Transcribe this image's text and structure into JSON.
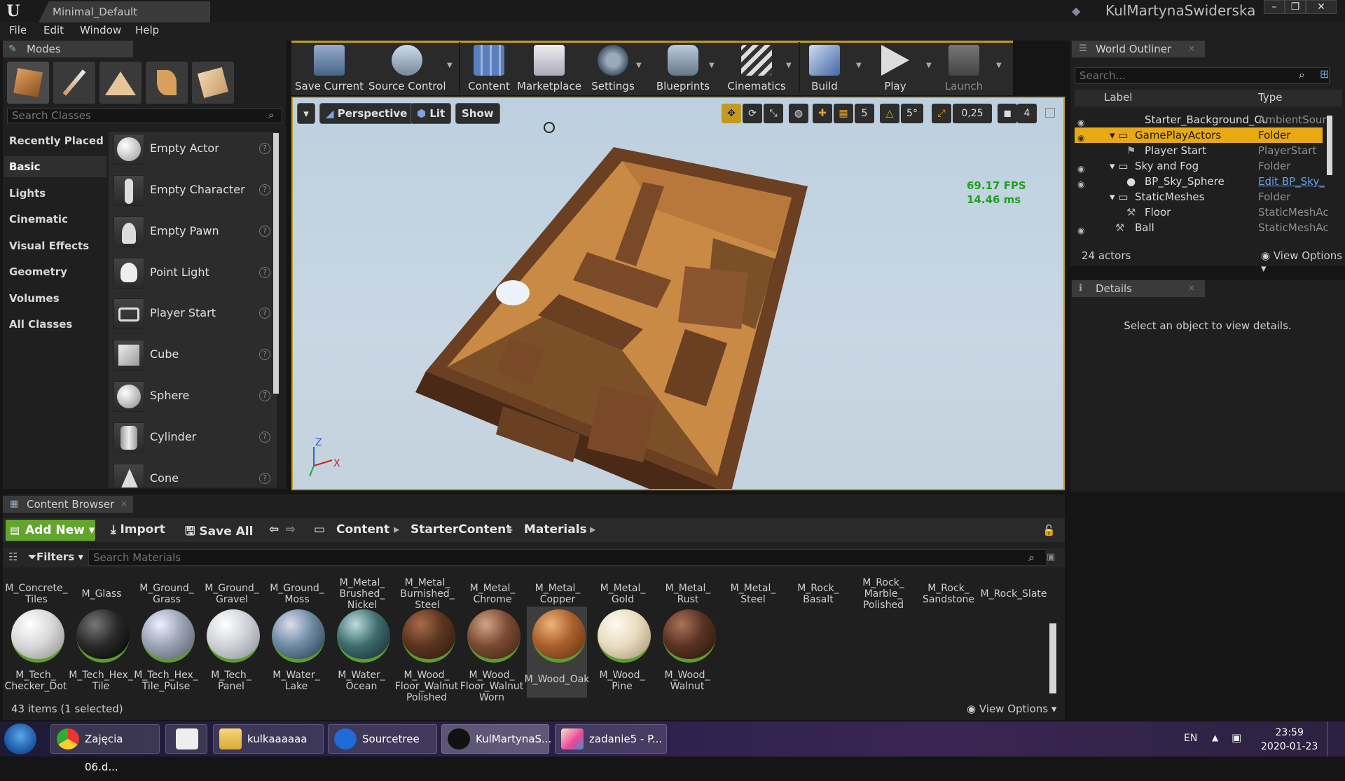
{
  "window": {
    "tab_title": "Minimal_Default",
    "user": "KulMartynaSwiderska"
  },
  "menu": [
    "File",
    "Edit",
    "Window",
    "Help"
  ],
  "modes": {
    "tab": "Modes",
    "search_placeholder": "Search Classes",
    "categories": [
      "Recently Placed",
      "Basic",
      "Lights",
      "Cinematic",
      "Visual Effects",
      "Geometry",
      "Volumes",
      "All Classes"
    ],
    "active_category": "Basic",
    "items": [
      "Empty Actor",
      "Empty Character",
      "Empty Pawn",
      "Point Light",
      "Player Start",
      "Cube",
      "Sphere",
      "Cylinder",
      "Cone"
    ]
  },
  "toolbar": {
    "buttons": [
      "Save Current",
      "Source Control",
      "Content",
      "Marketplace",
      "Settings",
      "Blueprints",
      "Cinematics",
      "Build",
      "Play",
      "Launch"
    ]
  },
  "viewport": {
    "mode_dropdown": "▾",
    "perspective": "Perspective",
    "lit": "Lit",
    "show": "Show",
    "grid_snap": "5",
    "rot_snap": "5°",
    "scale_snap": "0,25",
    "cam_speed": "4",
    "fps": "69.17 FPS",
    "ms": "14.46 ms",
    "axis_z": "Z",
    "axis_x": "X"
  },
  "outliner": {
    "tab": "World Outliner",
    "search_placeholder": "Search...",
    "col_label": "Label",
    "col_type": "Type",
    "rows": [
      {
        "label": "Starter_Background_Cu",
        "type": "AmbientSoun",
        "indent": 2
      },
      {
        "label": "GamePlayActors",
        "type": "Folder",
        "indent": 1,
        "selected": true
      },
      {
        "label": "Player Start",
        "type": "PlayerStart",
        "indent": 2
      },
      {
        "label": "Sky and Fog",
        "type": "Folder",
        "indent": 1
      },
      {
        "label": "BP_Sky_Sphere",
        "type": "Edit BP_Sky_",
        "indent": 2
      },
      {
        "label": "StaticMeshes",
        "type": "Folder",
        "indent": 1
      },
      {
        "label": "Floor",
        "type": "StaticMeshAc",
        "indent": 2
      },
      {
        "label": "Ball",
        "type": "StaticMeshAc",
        "indent": 1
      }
    ],
    "actors_count": "24 actors",
    "view_options": "View Options"
  },
  "details": {
    "tab": "Details",
    "message": "Select an object to view details."
  },
  "content_browser": {
    "tab": "Content Browser",
    "add_new": "Add New",
    "import": "Import",
    "save_all": "Save All",
    "breadcrumb": [
      "Content",
      "StarterContent",
      "Materials"
    ],
    "filters": "Filters",
    "search_placeholder": "Search Materials",
    "top_row": [
      "M_Concrete_ Tiles",
      "M_Glass",
      "M_Ground_ Grass",
      "M_Ground_ Gravel",
      "M_Ground_ Moss",
      "M_Metal_ Brushed_ Nickel",
      "M_Metal_ Burnished_ Steel",
      "M_Metal_ Chrome",
      "M_Metal_ Copper",
      "M_Metal_ Gold",
      "M_Metal_ Rust",
      "M_Metal_ Steel",
      "M_Rock_ Basalt",
      "M_Rock_ Marble_ Polished",
      "M_Rock_ Sandstone",
      "M_Rock_Slate"
    ],
    "materials": [
      {
        "label": "M_Tech_ Checker_Dot",
        "color": "#d9d9d9"
      },
      {
        "label": "M_Tech_Hex_ Tile",
        "color": "#2a2a2a"
      },
      {
        "label": "M_Tech_Hex_ Tile_Pulse",
        "color": "#9aa4b4"
      },
      {
        "label": "M_Tech_ Panel",
        "color": "#cfd2d6"
      },
      {
        "label": "M_Water_ Lake",
        "color": "#6d8ba3"
      },
      {
        "label": "M_Water_ Ocean",
        "color": "#3f6d6d"
      },
      {
        "label": "M_Wood_ Floor_Walnut Polished",
        "color": "#5b3520"
      },
      {
        "label": "M_Wood_ Floor_Walnut Worn",
        "color": "#7a4a33"
      },
      {
        "label": "M_Wood_Oak",
        "color": "#a9602c",
        "selected": true
      },
      {
        "label": "M_Wood_ Pine",
        "color": "#e8dcc0"
      },
      {
        "label": "M_Wood_ Walnut",
        "color": "#5a3322"
      }
    ],
    "items_count": "43 items (1 selected)",
    "view_options": "View Options"
  },
  "taskbar": {
    "tasks": [
      "Zajęcia 06.d...",
      "",
      "kulkaaaaaa",
      "Sourcetree",
      "KulMartynaS...",
      "zadanie5 - P..."
    ],
    "lang": "EN",
    "time": "23:59",
    "date": "2020-01-23"
  }
}
